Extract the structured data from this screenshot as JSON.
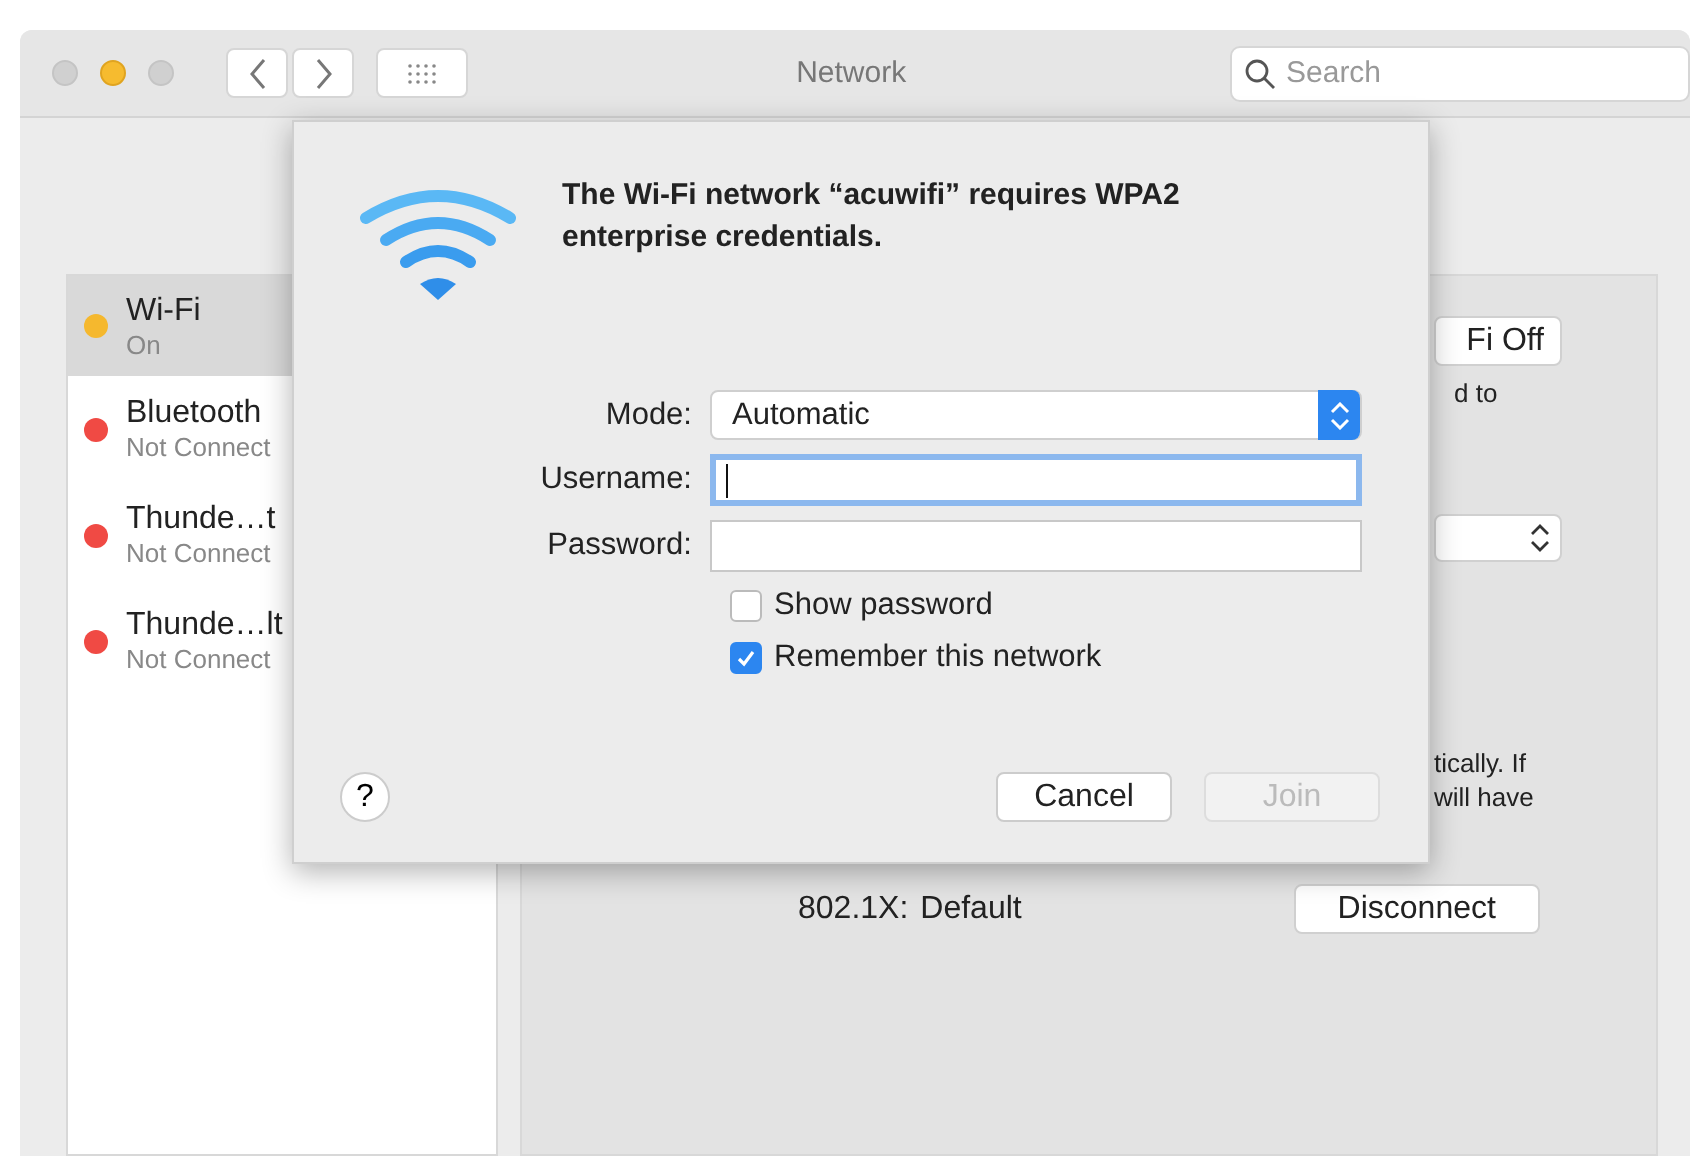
{
  "window": {
    "title": "Network",
    "search": {
      "placeholder": "Search"
    }
  },
  "sidebar": {
    "items": [
      {
        "name": "Wi-Fi",
        "status": "On",
        "color": "#f5b82e",
        "selected": true
      },
      {
        "name": "Bluetooth",
        "status": "Not Connect",
        "color": "#f04a44",
        "selected": false
      },
      {
        "name": "Thunde…t",
        "status": "Not Connect",
        "color": "#f04a44",
        "selected": false
      },
      {
        "name": "Thunde…lt",
        "status": "Not Connect",
        "color": "#f04a44",
        "selected": false
      }
    ]
  },
  "panel": {
    "wifi_button": "Fi Off",
    "note": "d to",
    "note_2": "tically. If",
    "note_3": "will have",
    "security_label": "802.1X:",
    "security_value": "Default",
    "disconnect_button": "Disconnect"
  },
  "dialog": {
    "title": "The Wi-Fi network “acuwifi” requires WPA2 enterprise credentials.",
    "fields": [
      {
        "kind": "select",
        "label": "Mode:",
        "value": "Automatic"
      },
      {
        "kind": "text",
        "label": "Username:",
        "focused": true
      },
      {
        "kind": "text",
        "label": "Password:",
        "focused": false
      }
    ],
    "checkboxes": [
      {
        "label": "Show password",
        "checked": false
      },
      {
        "label": "Remember this network",
        "checked": true
      }
    ],
    "help": "?",
    "buttons": [
      {
        "label": "Cancel",
        "disabled": false
      },
      {
        "label": "Join",
        "disabled": true
      }
    ]
  }
}
